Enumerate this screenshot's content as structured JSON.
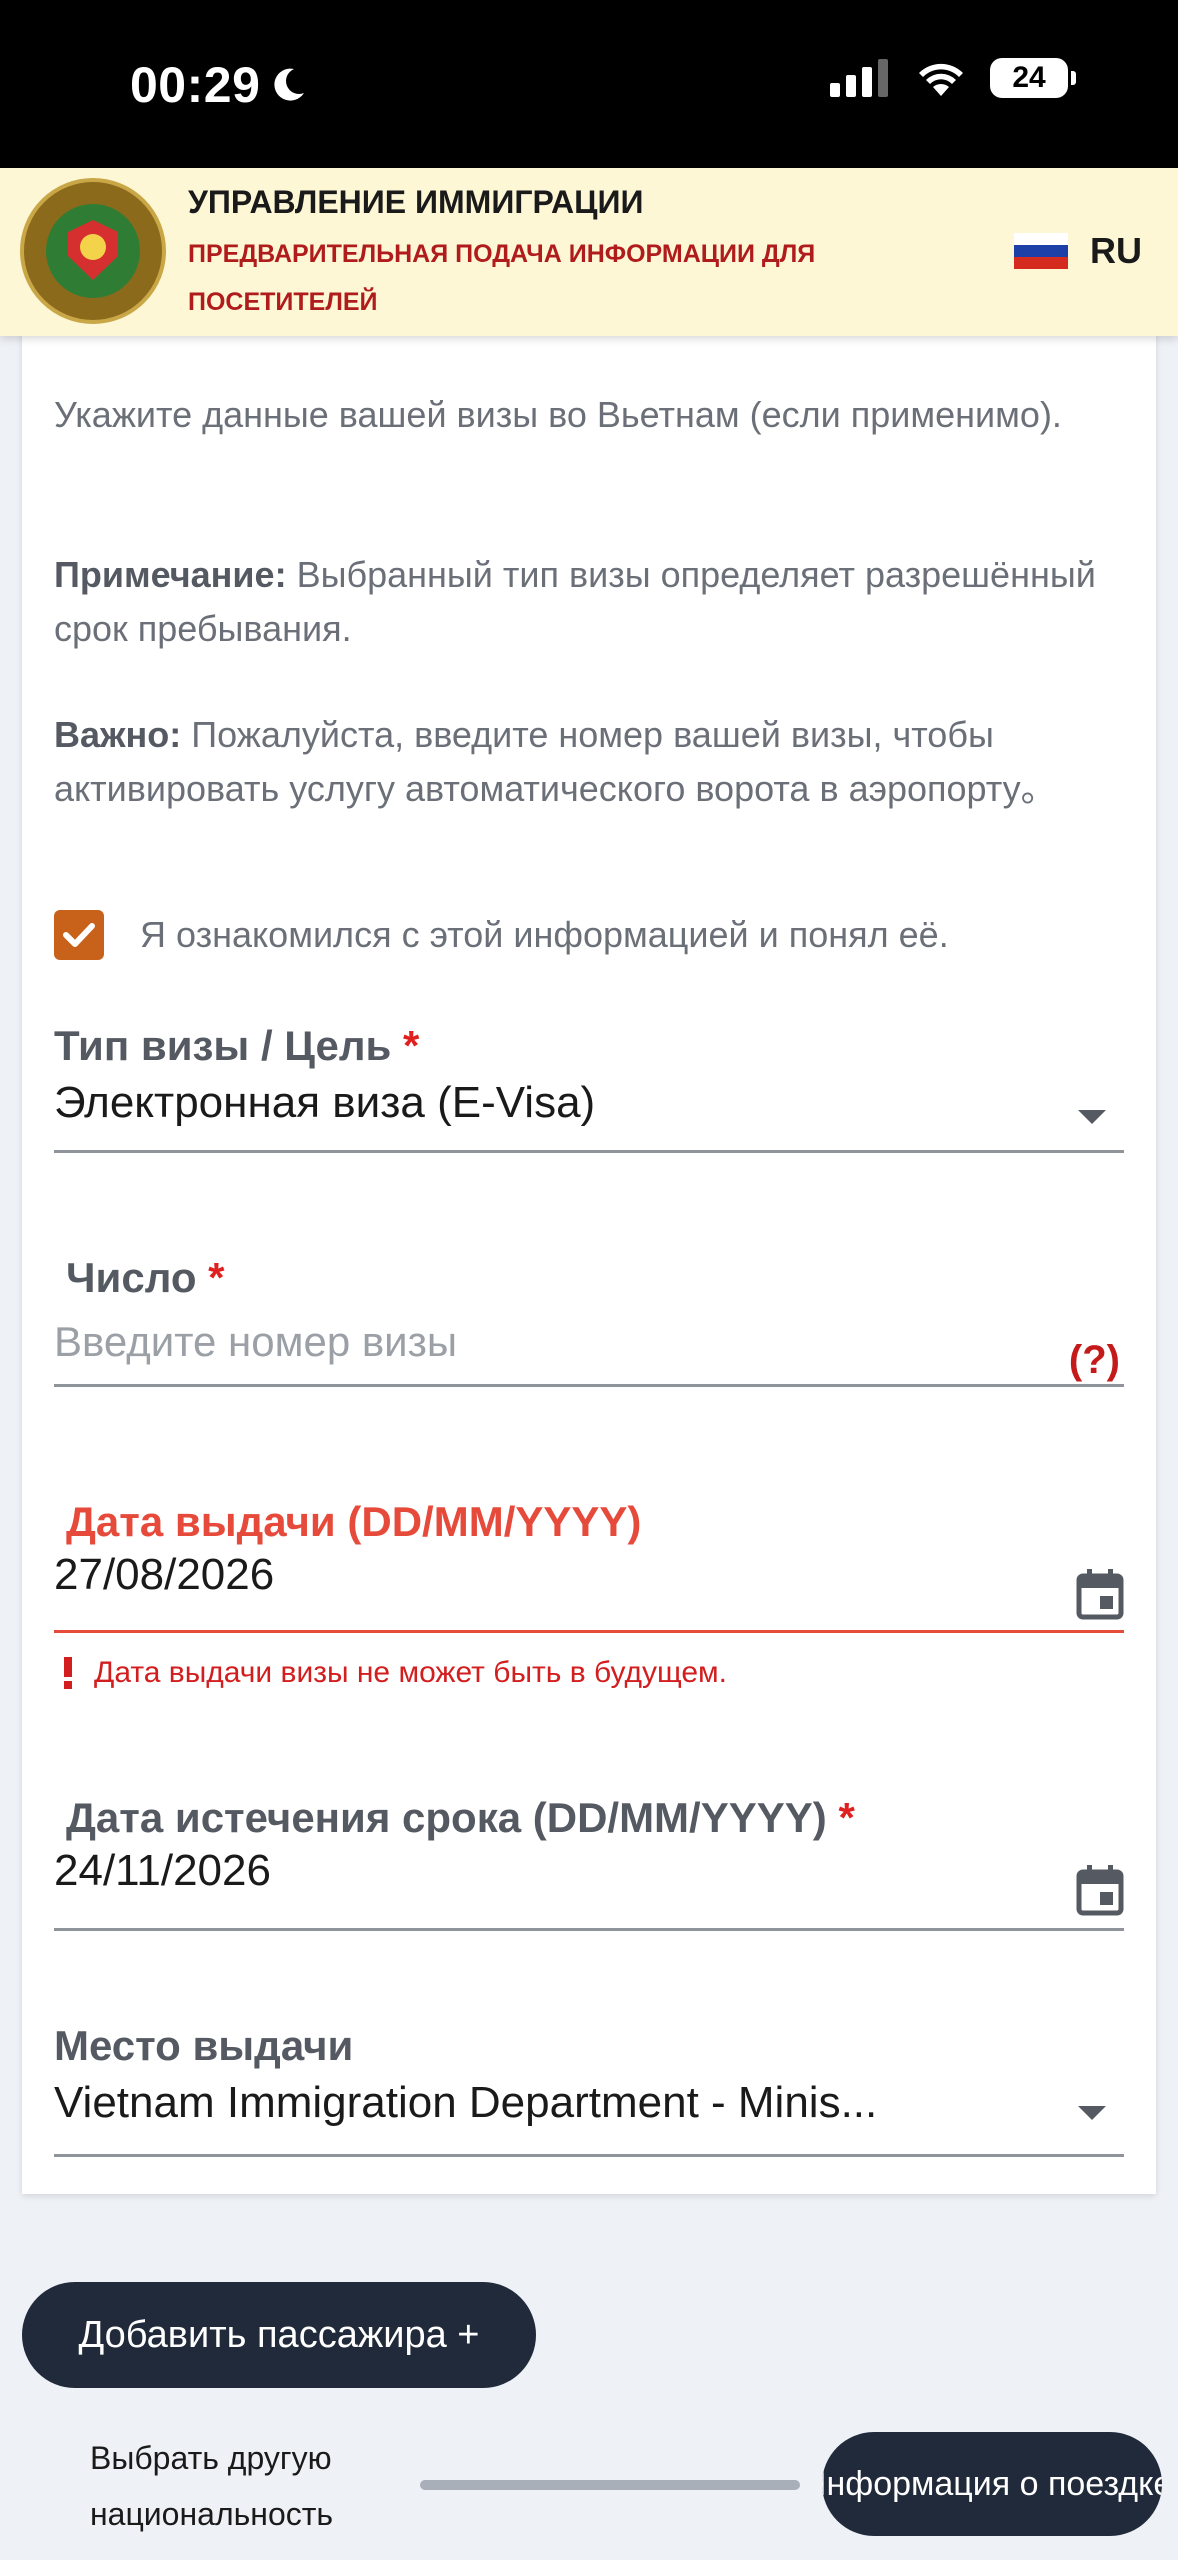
{
  "status_bar": {
    "time": "00:29",
    "battery": "24"
  },
  "header": {
    "title": "УПРАВЛЕНИЕ ИММИГРАЦИИ",
    "subtitle": "ПРЕДВАРИТЕЛЬНАЯ ПОДАЧА ИНФОРМАЦИИ ДЛЯ ПОСЕТИТЕЛЕЙ",
    "language": "RU"
  },
  "visa_section": {
    "intro": "Укажите данные вашей визы во Вьетнам (если применимо).",
    "note_label": "Примечание:",
    "note_text": " Выбранный тип визы определяет разрешённый срок пребывания.",
    "important_label": "Важно:",
    "important_text": " Пожалуйста, введите номер вашей визы, чтобы активировать услугу автоматического ворота в аэропорту。",
    "acknowledge_label": "Я ознакомился с этой информацией и понял её.",
    "acknowledged": true,
    "visa_type": {
      "label": "Тип визы / Цель",
      "value": "Электронная виза (E-Visa)"
    },
    "number": {
      "label": "Число",
      "placeholder": "Введите номер визы",
      "help": "(?)"
    },
    "issue_date": {
      "label": "Дата выдачи (DD/MM/YYYY)",
      "value": "27/08/2026",
      "error": "Дата выдачи визы не может быть в будущем."
    },
    "expiry_date": {
      "label": "Дата истечения срока (DD/MM/YYYY)",
      "value": "24/11/2026"
    },
    "place_of_issue": {
      "label": "Место выдачи",
      "value": "Vietnam Immigration Department - Minis..."
    }
  },
  "footer": {
    "add_passenger": "Добавить пассажира +",
    "choose_nationality": "Выбрать другую национальность",
    "trip_info": "Информация о поездке"
  },
  "colors": {
    "header_bg": "#fdf7d6",
    "header_subtitle": "#b01c1c",
    "checkbox": "#c8621a",
    "error": "#e64a3b",
    "button_bg": "#202a3a"
  }
}
